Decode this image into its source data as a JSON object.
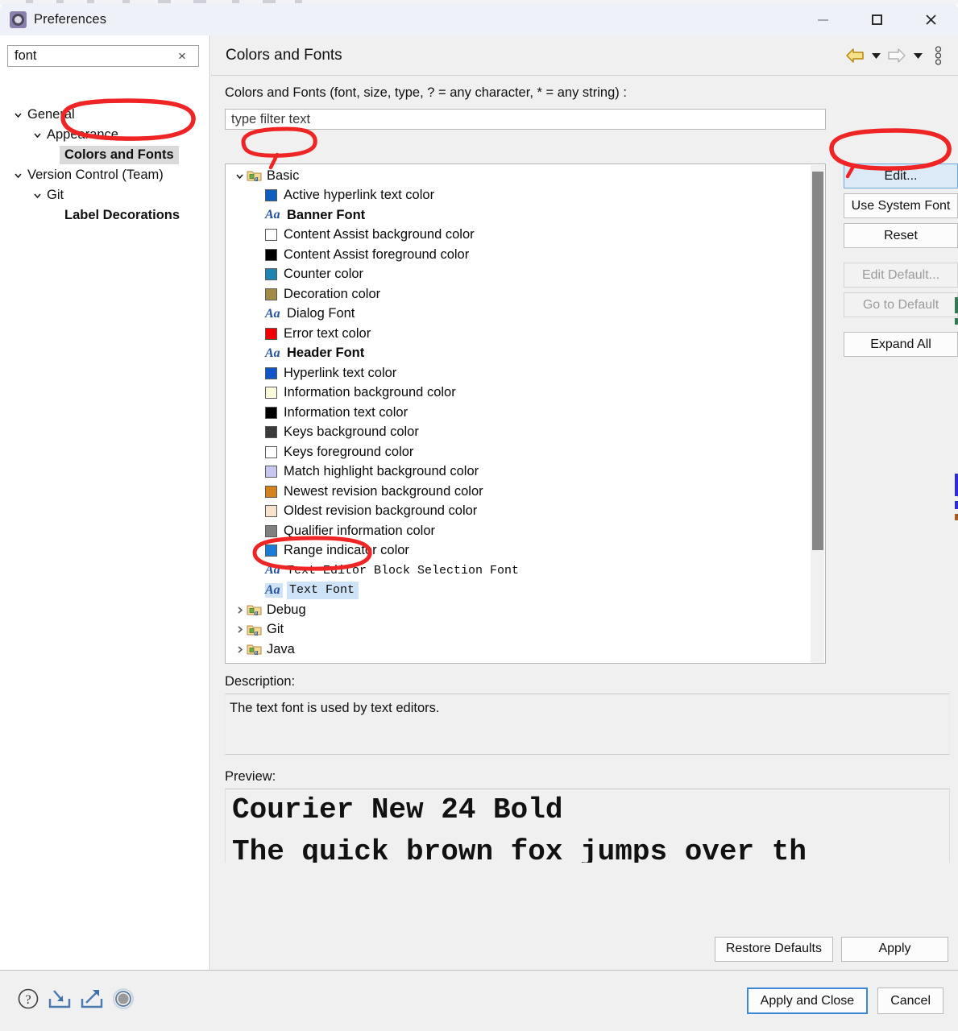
{
  "window": {
    "title": "Preferences",
    "app_icon": "preferences-gear-icon",
    "controls": {
      "minimize": "minimize-icon",
      "maximize": "maximize-icon",
      "close": "close-icon"
    }
  },
  "sidebar": {
    "filter": {
      "value": "font",
      "placeholder": "type filter text",
      "clear_label": "×"
    },
    "items": [
      {
        "label": "General",
        "indent": 0,
        "state": "expanded",
        "style": "normal"
      },
      {
        "label": "Appearance",
        "indent": 1,
        "state": "expanded",
        "style": "normal"
      },
      {
        "label": "Colors and Fonts",
        "indent": 2,
        "state": "leaf",
        "style": "selected"
      },
      {
        "label": "Version Control (Team)",
        "indent": 0,
        "state": "expanded",
        "style": "normal"
      },
      {
        "label": "Git",
        "indent": 1,
        "state": "expanded",
        "style": "normal"
      },
      {
        "label": "Label Decorations",
        "indent": 2,
        "state": "leaf",
        "style": "bold"
      }
    ]
  },
  "page": {
    "title": "Colors and Fonts",
    "toolbar": {
      "back": "back-arrow-icon",
      "back_menu": "chevron-down-icon",
      "forward": "forward-arrow-icon",
      "forward_menu": "chevron-down-icon",
      "overflow": "vertical-dots-icon"
    },
    "legend": "Colors and Fonts (font, size, type, ? = any character, * = any string) :",
    "tree_filter_placeholder": "type filter text",
    "tree": [
      {
        "label": "Basic",
        "kind": "folder",
        "indent": 0,
        "expander": "expanded"
      },
      {
        "label": "Active hyperlink text color",
        "kind": "swatch",
        "indent": 1,
        "color": "#0e5ec0"
      },
      {
        "label": "Banner Font",
        "kind": "font",
        "indent": 1,
        "bold": true
      },
      {
        "label": "Content Assist background color",
        "kind": "swatch",
        "indent": 1,
        "color": "#ffffff"
      },
      {
        "label": "Content Assist foreground color",
        "kind": "swatch",
        "indent": 1,
        "color": "#000000"
      },
      {
        "label": "Counter color",
        "kind": "swatch",
        "indent": 1,
        "color": "#2183b0"
      },
      {
        "label": "Decoration color",
        "kind": "swatch",
        "indent": 1,
        "color": "#a28b47"
      },
      {
        "label": "Dialog Font",
        "kind": "font",
        "indent": 1,
        "bold": false
      },
      {
        "label": "Error text color",
        "kind": "swatch",
        "indent": 1,
        "color": "#f50000"
      },
      {
        "label": "Header Font",
        "kind": "font",
        "indent": 1,
        "bold": true
      },
      {
        "label": "Hyperlink text color",
        "kind": "swatch",
        "indent": 1,
        "color": "#0f55c4"
      },
      {
        "label": "Information background color",
        "kind": "swatch",
        "indent": 1,
        "color": "#fcfcdc"
      },
      {
        "label": "Information text color",
        "kind": "swatch",
        "indent": 1,
        "color": "#000000"
      },
      {
        "label": "Keys background color",
        "kind": "swatch",
        "indent": 1,
        "color": "#3b3b3b"
      },
      {
        "label": "Keys foreground color",
        "kind": "swatch",
        "indent": 1,
        "color": "#ffffff"
      },
      {
        "label": "Match highlight background color",
        "kind": "swatch",
        "indent": 1,
        "color": "#c7c7f0"
      },
      {
        "label": "Newest revision background color",
        "kind": "swatch",
        "indent": 1,
        "color": "#d4821d"
      },
      {
        "label": "Oldest revision background color",
        "kind": "swatch",
        "indent": 1,
        "color": "#f6e2cd"
      },
      {
        "label": "Qualifier information color",
        "kind": "swatch",
        "indent": 1,
        "color": "#808080"
      },
      {
        "label": "Range indicator color",
        "kind": "swatch",
        "indent": 1,
        "color": "#1b7cd6"
      },
      {
        "label": "Text Editor Block Selection Font",
        "kind": "font",
        "indent": 1,
        "mono": true
      },
      {
        "label": "Text Font",
        "kind": "font",
        "indent": 1,
        "mono": true,
        "selected": true
      },
      {
        "label": "Debug",
        "kind": "folder",
        "indent": 0,
        "expander": "collapsed"
      },
      {
        "label": "Git",
        "kind": "folder",
        "indent": 0,
        "expander": "collapsed"
      },
      {
        "label": "Java",
        "kind": "folder",
        "indent": 0,
        "expander": "collapsed"
      }
    ],
    "buttons": [
      {
        "label": "Edit...",
        "state": "primary"
      },
      {
        "label": "Use System Font",
        "state": "enabled"
      },
      {
        "label": "Reset",
        "state": "enabled"
      },
      {
        "label": "Edit Default...",
        "state": "disabled"
      },
      {
        "label": "Go to Default",
        "state": "disabled"
      },
      {
        "label": "Expand All",
        "state": "enabled"
      }
    ],
    "description_label": "Description:",
    "description_text": "The text font is used by text editors.",
    "preview_label": "Preview:",
    "preview_lines": [
      "Courier New 24 Bold",
      "The quick brown fox jumps over th"
    ],
    "restore_defaults_label": "Restore Defaults",
    "apply_label": "Apply"
  },
  "footer": {
    "icons": [
      {
        "name": "help-icon"
      },
      {
        "name": "import-icon"
      },
      {
        "name": "export-icon"
      },
      {
        "name": "circle-icon"
      }
    ],
    "apply_and_close_label": "Apply and Close",
    "cancel_label": "Cancel"
  },
  "annotations": {
    "color": "#ef2525",
    "marks": [
      {
        "target": "sidebar-item-colors-and-fonts",
        "shape": "ellipse"
      },
      {
        "target": "tree-row-basic",
        "shape": "ellipse"
      },
      {
        "target": "tree-row-text-font",
        "shape": "ellipse"
      },
      {
        "target": "edit-button",
        "shape": "ellipse"
      }
    ]
  }
}
